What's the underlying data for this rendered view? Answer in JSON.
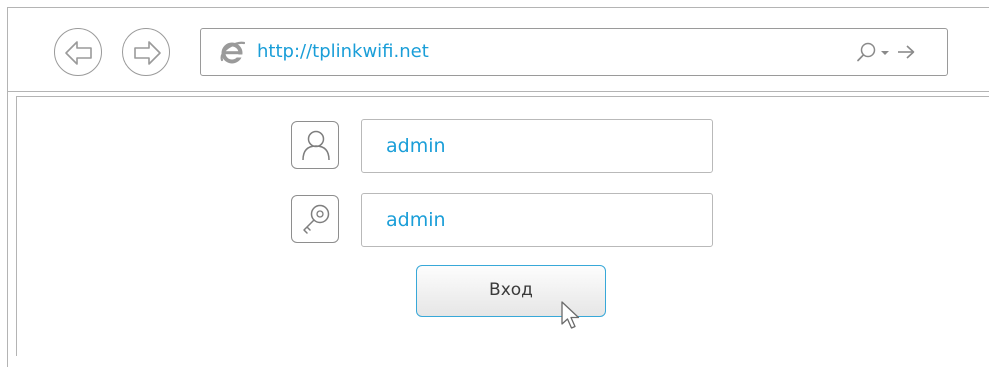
{
  "browser": {
    "address_bar": {
      "url": "http://tplinkwifi.net"
    },
    "icons": {
      "back": "back-arrow-icon",
      "forward": "forward-arrow-icon",
      "browser_logo": "internet-explorer-icon",
      "search": "search-icon",
      "dropdown": "chevron-down-icon",
      "go": "go-arrow-icon"
    }
  },
  "login_form": {
    "username": {
      "value": "admin",
      "icon": "user-icon"
    },
    "password": {
      "value": "admin",
      "icon": "key-icon"
    },
    "submit_label": "Вход",
    "cursor_icon": "mouse-pointer-icon"
  },
  "colors": {
    "accent": "#1a9ed8",
    "button_border": "#38a8d8",
    "frame_border": "#b4b4b4"
  }
}
